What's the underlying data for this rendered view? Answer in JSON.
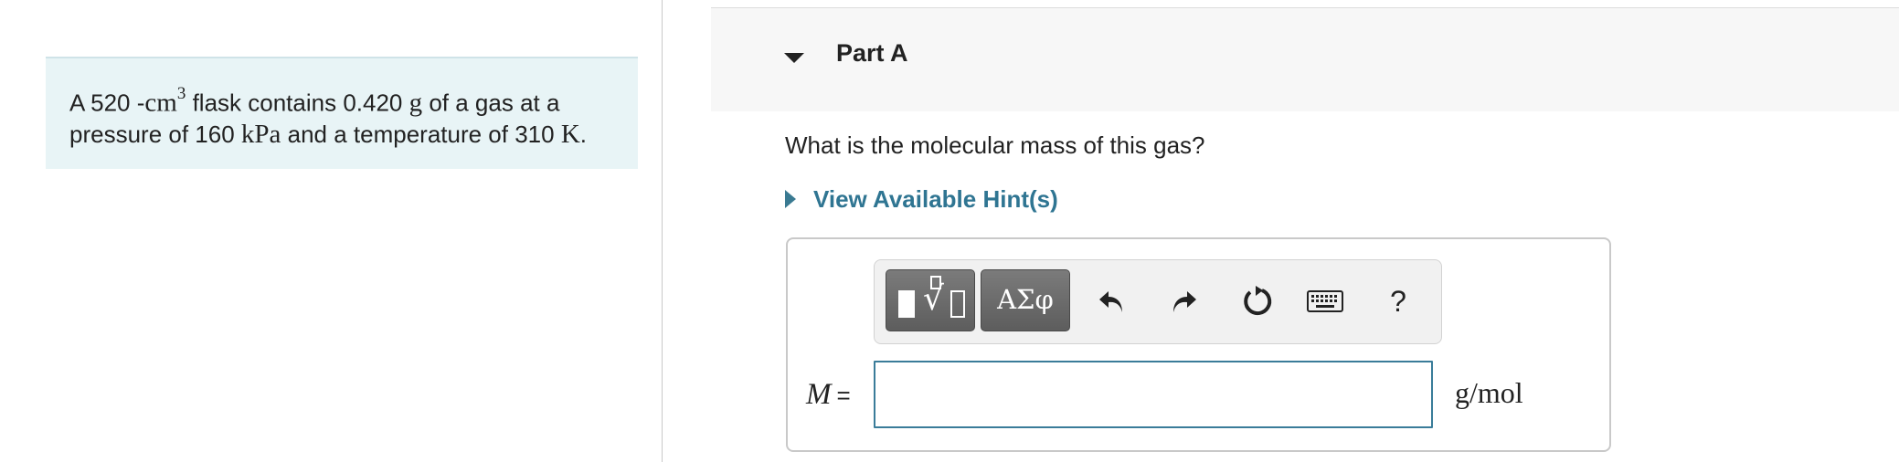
{
  "problem": {
    "part1": "A 520 -",
    "volume_unit": "cm",
    "volume_exponent": "3",
    "part2": " flask contains 0.420 ",
    "mass_unit": "g",
    "part3": " of a gas at a",
    "part4": "pressure of 160 ",
    "pressure_unit": "kPa",
    "part5": " and a temperature of 310 ",
    "temperature_unit": "K",
    "part6": "."
  },
  "part": {
    "title": "Part A",
    "question": "What is the molecular mass of this gas?",
    "hint_link": "View Available Hint(s)"
  },
  "toolbar": {
    "symbols_label": "ΑΣφ",
    "help_label": "?",
    "icons": [
      "templates-icon",
      "symbols-icon",
      "undo-icon",
      "redo-icon",
      "reset-icon",
      "keyboard-icon",
      "help-icon"
    ]
  },
  "answer": {
    "variable": "M",
    "equals": "=",
    "value": "",
    "unit": "g/mol"
  },
  "colors": {
    "problem_bg": "#e8f4f6",
    "hint_link": "#2f7592",
    "input_border": "#3a7c99",
    "toolbar_dark": "#6a6a6a"
  }
}
